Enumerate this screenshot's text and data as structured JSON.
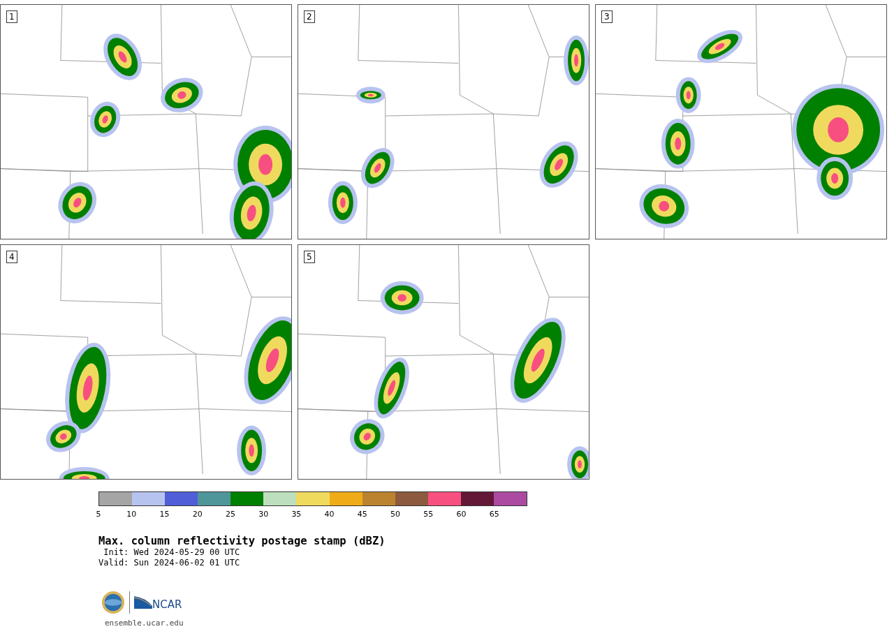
{
  "panels": [
    {
      "label": "1"
    },
    {
      "label": "2"
    },
    {
      "label": "3"
    },
    {
      "label": "4"
    },
    {
      "label": "5"
    }
  ],
  "colorbar": {
    "segments": [
      {
        "color": "#a5a5a5"
      },
      {
        "color": "#b7c3ef"
      },
      {
        "color": "#505fd8"
      },
      {
        "color": "#4f969a"
      },
      {
        "color": "#008000"
      },
      {
        "color": "#bedfbd"
      },
      {
        "color": "#f0da5e"
      },
      {
        "color": "#f0ac18"
      },
      {
        "color": "#bb832f"
      },
      {
        "color": "#8c5a3e"
      },
      {
        "color": "#f75080"
      },
      {
        "color": "#621836"
      },
      {
        "color": "#ac4aa2"
      }
    ],
    "ticks": [
      "5",
      "10",
      "15",
      "20",
      "25",
      "30",
      "35",
      "40",
      "45",
      "50",
      "55",
      "60",
      "65"
    ]
  },
  "title": "Max. column reflectivity postage stamp (dBZ)",
  "init": " Init: Wed 2024-05-29 00 UTC",
  "valid": "Valid: Sun 2024-06-02 01 UTC",
  "logo_text": "NCAR",
  "site": "ensemble.ucar.edu"
}
